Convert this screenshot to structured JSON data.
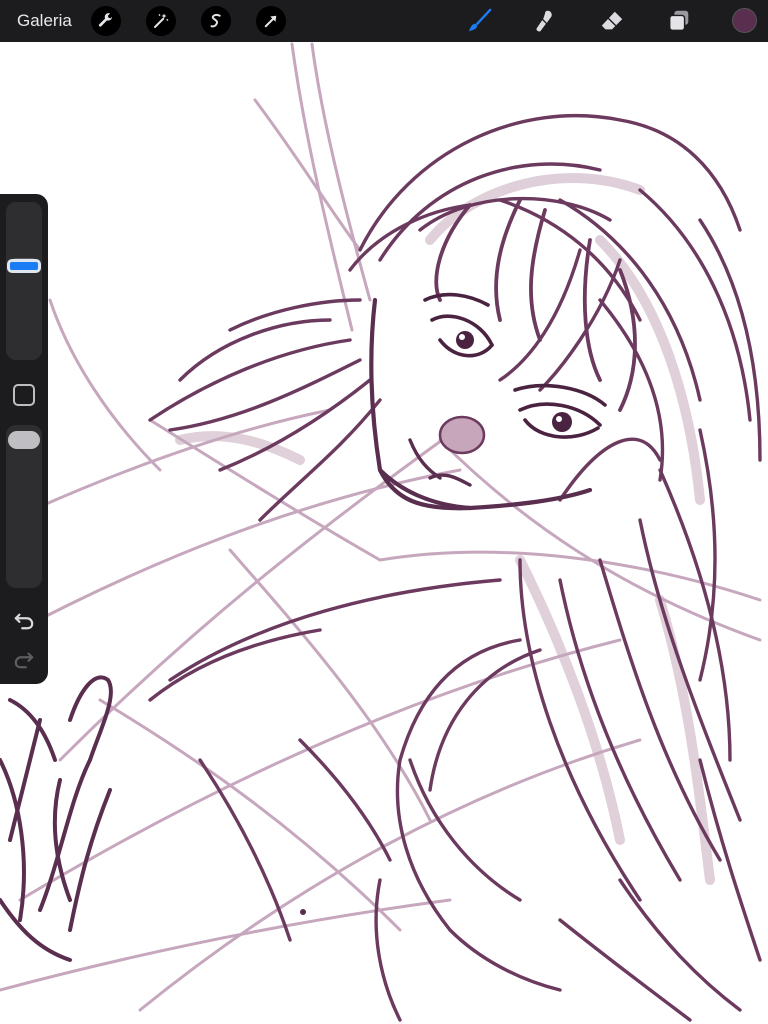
{
  "toolbar": {
    "gallery_label": "Galeria",
    "left_tools": [
      {
        "icon": "wrench-icon",
        "name": "actions"
      },
      {
        "icon": "magic-wand-icon",
        "name": "adjustments"
      },
      {
        "icon": "selection-icon",
        "name": "selection"
      },
      {
        "icon": "arrow-cursor-icon",
        "name": "transform"
      }
    ],
    "right_tools": [
      {
        "icon": "brush-icon",
        "name": "paint",
        "active": true
      },
      {
        "icon": "smudge-icon",
        "name": "smudge",
        "active": false
      },
      {
        "icon": "eraser-icon",
        "name": "eraser",
        "active": false
      },
      {
        "icon": "layers-icon",
        "name": "layers",
        "active": false
      }
    ],
    "current_color": "#5a2e4f"
  },
  "sidebar": {
    "brush_size_level": 0.62,
    "brush_opacity_level": 1.0
  },
  "colors": {
    "toolbar_bg": "#1c1c1e",
    "active_accent": "#1b7cf5",
    "stroke": "#6b3a5e"
  }
}
